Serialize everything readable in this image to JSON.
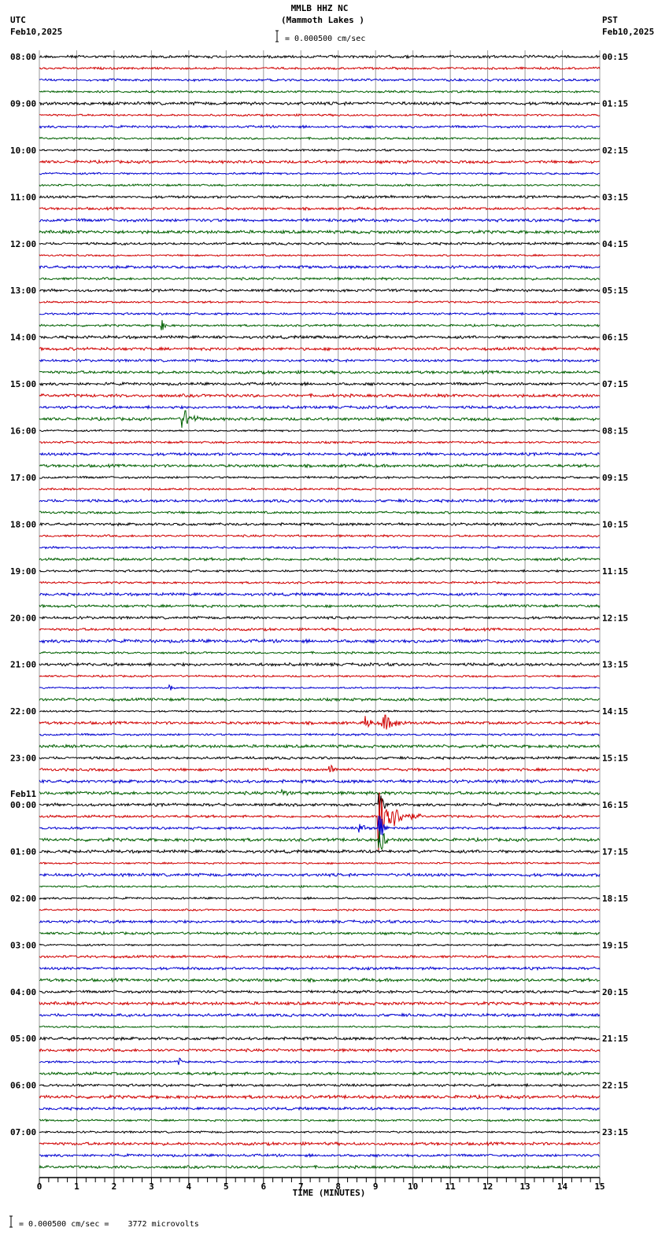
{
  "header": {
    "station": "MMLB HHZ NC",
    "location": "(Mammoth Lakes )",
    "left_tz": "UTC",
    "left_date": "Feb10,2025",
    "right_tz": "PST",
    "right_date": "Feb10,2025",
    "scale": "= 0.000500 cm/sec"
  },
  "footer": {
    "scale": "= 0.000500 cm/sec =    3772 microvolts"
  },
  "chart_data": {
    "type": "line",
    "title": "MMLB HHZ NC (Mammoth Lakes )",
    "xlabel": "TIME (MINUTES)",
    "xlim": [
      0,
      15
    ],
    "x_ticks": [
      "0",
      "1",
      "2",
      "3",
      "4",
      "5",
      "6",
      "7",
      "8",
      "9",
      "10",
      "11",
      "12",
      "13",
      "14",
      "15"
    ],
    "left_labels": [
      "08:00",
      "09:00",
      "10:00",
      "11:00",
      "12:00",
      "13:00",
      "14:00",
      "15:00",
      "16:00",
      "17:00",
      "18:00",
      "19:00",
      "20:00",
      "21:00",
      "22:00",
      "23:00",
      "00:00",
      "01:00",
      "02:00",
      "03:00",
      "04:00",
      "05:00",
      "06:00",
      "07:00"
    ],
    "date_change_label": "Feb11",
    "date_change_hour_index": 16,
    "right_labels": [
      "00:15",
      "01:15",
      "02:15",
      "03:15",
      "04:15",
      "05:15",
      "06:15",
      "07:15",
      "08:15",
      "09:15",
      "10:15",
      "11:15",
      "12:15",
      "13:15",
      "14:15",
      "15:15",
      "16:15",
      "17:15",
      "18:15",
      "19:15",
      "20:15",
      "21:15",
      "22:15",
      "23:15"
    ],
    "traces_per_hour": 4,
    "trace_colors": [
      "#000000",
      "#d00000",
      "#0000d0",
      "#006000"
    ],
    "grid": true,
    "events": [
      {
        "trace": 23,
        "minute": 3.3,
        "amplitude": 6,
        "duration": 0.2
      },
      {
        "trace": 31,
        "minute": 3.85,
        "amplitude": 14,
        "duration": 0.7
      },
      {
        "trace": 54,
        "minute": 3.5,
        "amplitude": 5,
        "duration": 0.2
      },
      {
        "trace": 57,
        "minute": 8.75,
        "amplitude": 8,
        "duration": 0.4
      },
      {
        "trace": 57,
        "minute": 9.2,
        "amplitude": 11,
        "duration": 1.0
      },
      {
        "trace": 61,
        "minute": 7.8,
        "amplitude": 5,
        "duration": 0.5
      },
      {
        "trace": 63,
        "minute": 6.5,
        "amplitude": 5,
        "duration": 0.4
      },
      {
        "trace": 65,
        "minute": 9.1,
        "amplitude": 45,
        "duration": 1.2
      },
      {
        "trace": 66,
        "minute": 8.6,
        "amplitude": 5,
        "duration": 0.4
      },
      {
        "trace": 86,
        "minute": 3.75,
        "amplitude": 6,
        "duration": 0.2
      }
    ]
  }
}
